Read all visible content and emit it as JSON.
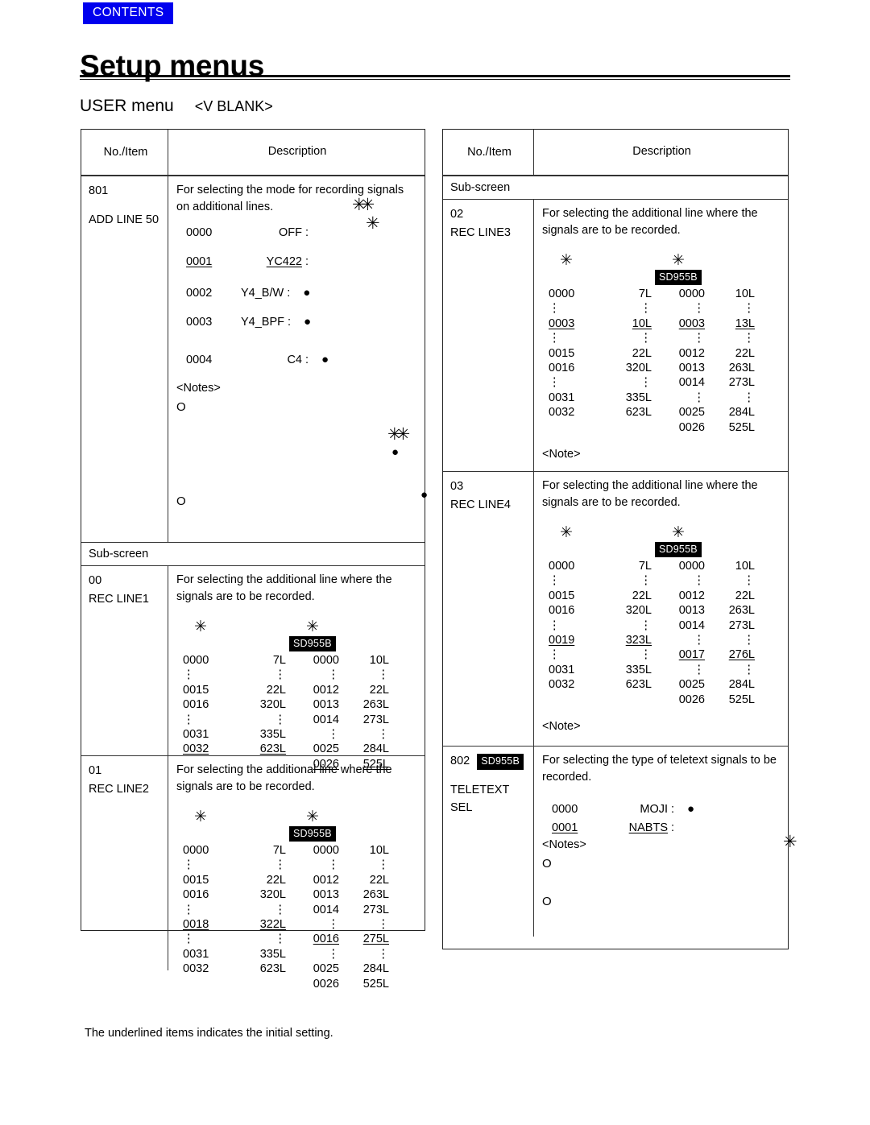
{
  "header": {
    "contents_tab": "CONTENTS",
    "page_title": "Setup menus",
    "menu_name": "USER menu",
    "menu_section": "<V BLANK>"
  },
  "footer": {
    "note": "The underlined items indicates the initial setting."
  },
  "symbols": {
    "star": "✳",
    "double_star": "✳✳",
    "bullet": "●",
    "circle": "O",
    "colon_vertical": "⋮",
    "notes_label": "<Notes>",
    "note_label": "<Note>",
    "badge_sd955b": "SD955B"
  },
  "table_headers": {
    "no_item": "No./Item",
    "description": "Description"
  },
  "left_table": {
    "rows": [
      {
        "no": "801",
        "item": "ADD LINE 50",
        "desc_line1": "For selecting the mode for recording signals",
        "desc_line2": "on additional lines.",
        "options": [
          {
            "num": "0000",
            "label": "OFF",
            "colon": ":",
            "dot": "",
            "underlined": false,
            "label_indent": "wide"
          },
          {
            "num": "0001",
            "label": "YC422",
            "colon": ":",
            "dot": "",
            "underlined": true,
            "label_indent": "wide"
          },
          {
            "num": "0002",
            "label": "Y4_B/W",
            "colon": ":",
            "dot": "●",
            "underlined": false,
            "label_indent": "narrow"
          },
          {
            "num": "0003",
            "label": "Y4_BPF",
            "colon": ":",
            "dot": "●",
            "underlined": false,
            "label_indent": "narrow"
          },
          {
            "num": "0004",
            "label": "C4",
            "colon": ":",
            "dot": "●",
            "underlined": false,
            "label_indent": "wide"
          }
        ],
        "notes_label": "<Notes>",
        "note_bullets": [
          "O",
          "O"
        ]
      },
      {
        "subscreen": "Sub-screen"
      },
      {
        "no": "00",
        "item": "REC LINE1",
        "desc_line1": "For selecting the additional line where the",
        "desc_line2": "signals are to be recorded.",
        "badge": "SD955B",
        "table": [
          {
            "a": "0000",
            "b": "7L",
            "c": "0000",
            "d": "10L",
            "u": []
          },
          {
            "a": "⋮",
            "b": "⋮",
            "c": "⋮",
            "d": "⋮",
            "u": []
          },
          {
            "a": "0015",
            "b": "22L",
            "c": "0012",
            "d": "22L",
            "u": []
          },
          {
            "a": "0016",
            "b": "320L",
            "c": "0013",
            "d": "263L",
            "u": []
          },
          {
            "a": "⋮",
            "b": "⋮",
            "c": "0014",
            "d": "273L",
            "u": []
          },
          {
            "a": "0031",
            "b": "335L",
            "c": "⋮",
            "d": "⋮",
            "u": []
          },
          {
            "a": "0032",
            "b": "623L",
            "c": "0025",
            "d": "284L",
            "u": [
              "a",
              "b"
            ]
          },
          {
            "a": "",
            "b": "",
            "c": "0026",
            "d": "525L",
            "u": [
              "c",
              "d"
            ]
          }
        ]
      },
      {
        "no": "01",
        "item": "REC LINE2",
        "desc_line1": "For selecting the additional line where the",
        "desc_line2": "signals are to be recorded.",
        "badge": "SD955B",
        "table": [
          {
            "a": "0000",
            "b": "7L",
            "c": "0000",
            "d": "10L",
            "u": []
          },
          {
            "a": "⋮",
            "b": "⋮",
            "c": "⋮",
            "d": "⋮",
            "u": []
          },
          {
            "a": "0015",
            "b": "22L",
            "c": "0012",
            "d": "22L",
            "u": []
          },
          {
            "a": "0016",
            "b": "320L",
            "c": "0013",
            "d": "263L",
            "u": []
          },
          {
            "a": "⋮",
            "b": "⋮",
            "c": "0014",
            "d": "273L",
            "u": []
          },
          {
            "a": "0018",
            "b": "322L",
            "c": "⋮",
            "d": "⋮",
            "u": [
              "a",
              "b"
            ]
          },
          {
            "a": "⋮",
            "b": "⋮",
            "c": "0016",
            "d": "275L",
            "u": [
              "c",
              "d"
            ]
          },
          {
            "a": "0031",
            "b": "335L",
            "c": "⋮",
            "d": "⋮",
            "u": []
          },
          {
            "a": "0032",
            "b": "623L",
            "c": "0025",
            "d": "284L",
            "u": []
          },
          {
            "a": "",
            "b": "",
            "c": "0026",
            "d": "525L",
            "u": []
          }
        ]
      }
    ]
  },
  "right_table": {
    "rows": [
      {
        "subscreen": "Sub-screen"
      },
      {
        "no": "02",
        "item": "REC LINE3",
        "desc_line1": "For selecting the additional line where the",
        "desc_line2": "signals are to be recorded.",
        "badge": "SD955B",
        "table": [
          {
            "a": "0000",
            "b": "7L",
            "c": "0000",
            "d": "10L",
            "u": []
          },
          {
            "a": "⋮",
            "b": "⋮",
            "c": "⋮",
            "d": "⋮",
            "u": []
          },
          {
            "a": "0003",
            "b": "10L",
            "c": "0003",
            "d": "13L",
            "u": [
              "a",
              "b",
              "c",
              "d"
            ]
          },
          {
            "a": "⋮",
            "b": "⋮",
            "c": "⋮",
            "d": "⋮",
            "u": []
          },
          {
            "a": "0015",
            "b": "22L",
            "c": "0012",
            "d": "22L",
            "u": []
          },
          {
            "a": "0016",
            "b": "320L",
            "c": "0013",
            "d": "263L",
            "u": []
          },
          {
            "a": "⋮",
            "b": "⋮",
            "c": "0014",
            "d": "273L",
            "u": []
          },
          {
            "a": "0031",
            "b": "335L",
            "c": "⋮",
            "d": "⋮",
            "u": []
          },
          {
            "a": "0032",
            "b": "623L",
            "c": "0025",
            "d": "284L",
            "u": []
          },
          {
            "a": "",
            "b": "",
            "c": "0026",
            "d": "525L",
            "u": []
          }
        ],
        "note_label": "<Note>"
      },
      {
        "no": "03",
        "item": "REC LINE4",
        "desc_line1": "For selecting the additional line where the",
        "desc_line2": "signals are to be recorded.",
        "badge": "SD955B",
        "table": [
          {
            "a": "0000",
            "b": "7L",
            "c": "0000",
            "d": "10L",
            "u": []
          },
          {
            "a": "⋮",
            "b": "⋮",
            "c": "⋮",
            "d": "⋮",
            "u": []
          },
          {
            "a": "0015",
            "b": "22L",
            "c": "0012",
            "d": "22L",
            "u": []
          },
          {
            "a": "0016",
            "b": "320L",
            "c": "0013",
            "d": "263L",
            "u": []
          },
          {
            "a": "⋮",
            "b": "⋮",
            "c": "0014",
            "d": "273L",
            "u": []
          },
          {
            "a": "0019",
            "b": "323L",
            "c": "⋮",
            "d": "⋮",
            "u": [
              "a",
              "b"
            ]
          },
          {
            "a": "⋮",
            "b": "⋮",
            "c": "0017",
            "d": "276L",
            "u": [
              "c",
              "d"
            ]
          },
          {
            "a": "0031",
            "b": "335L",
            "c": "⋮",
            "d": "⋮",
            "u": []
          },
          {
            "a": "0032",
            "b": "623L",
            "c": "0025",
            "d": "284L",
            "u": []
          },
          {
            "a": "",
            "b": "",
            "c": "0026",
            "d": "525L",
            "u": []
          }
        ],
        "note_label": "<Note>"
      },
      {
        "no": "802",
        "no_badge": "SD955B",
        "item_line1": "TELETEXT",
        "item_line2": "SEL",
        "desc_line1": "For selecting the type of teletext signals to be",
        "desc_line2": "recorded.",
        "options": [
          {
            "num": "0000",
            "label": "MOJI",
            "colon": ":",
            "dot": "●",
            "underlined": false
          },
          {
            "num": "0001",
            "label": "NABTS",
            "colon": ":",
            "dot": "",
            "underlined": true
          }
        ],
        "notes_label": "<Notes>",
        "note_bullets": [
          "O",
          "O"
        ]
      }
    ]
  }
}
